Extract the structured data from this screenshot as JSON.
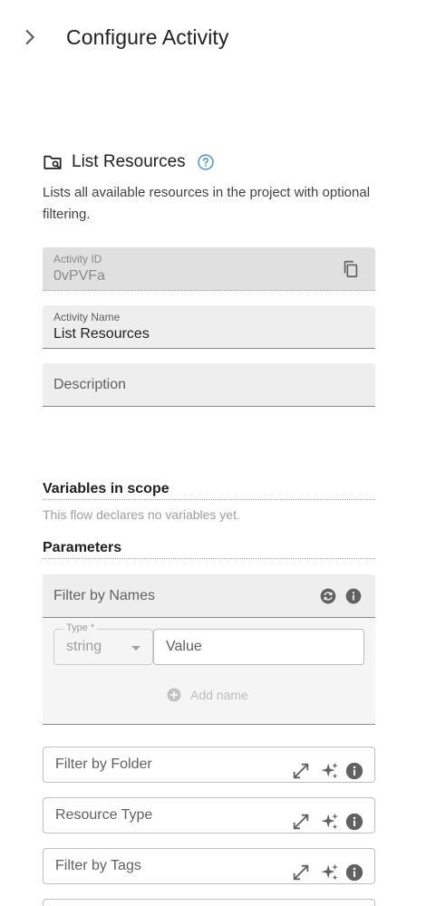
{
  "header": {
    "title": "Configure Activity",
    "toggle_icon": "chevron-right-icon"
  },
  "activity": {
    "icon": "folder-search-icon",
    "title": "List Resources",
    "help_icon": "help-icon",
    "description": "Lists all available resources in the project with optional filtering."
  },
  "fields": {
    "activity_id": {
      "label": "Activity ID",
      "value": "0vPVFa",
      "disabled": true,
      "action_icon": "copy-icon"
    },
    "activity_name": {
      "label": "Activity Name",
      "value": "List Resources"
    },
    "description": {
      "placeholder": "Description"
    }
  },
  "variables": {
    "title": "Variables in scope",
    "empty_text": "This flow declares no variables yet."
  },
  "parameters": {
    "title": "Parameters",
    "filter_by_names": {
      "label": "Filter by Names",
      "icons": [
        "reset-icon",
        "info-icon"
      ],
      "type_label": "Type *",
      "type_value": "string",
      "value_placeholder": "Value",
      "add_label": "Add name"
    },
    "inputs": [
      {
        "placeholder": "Filter by Folder",
        "icons": [
          "expand-icon",
          "sparkle-icon",
          "info-icon"
        ]
      },
      {
        "placeholder": "Resource Type",
        "icons": [
          "expand-icon",
          "sparkle-icon",
          "info-icon"
        ]
      },
      {
        "placeholder": "Filter by Tags",
        "icons": [
          "expand-icon",
          "sparkle-icon",
          "info-icon"
        ]
      }
    ]
  },
  "colors": {
    "accent": "#4a90d9",
    "text": "#212121",
    "muted": "#9e9e9e",
    "field_bg": "#eeeeee",
    "icon": "#616161"
  }
}
